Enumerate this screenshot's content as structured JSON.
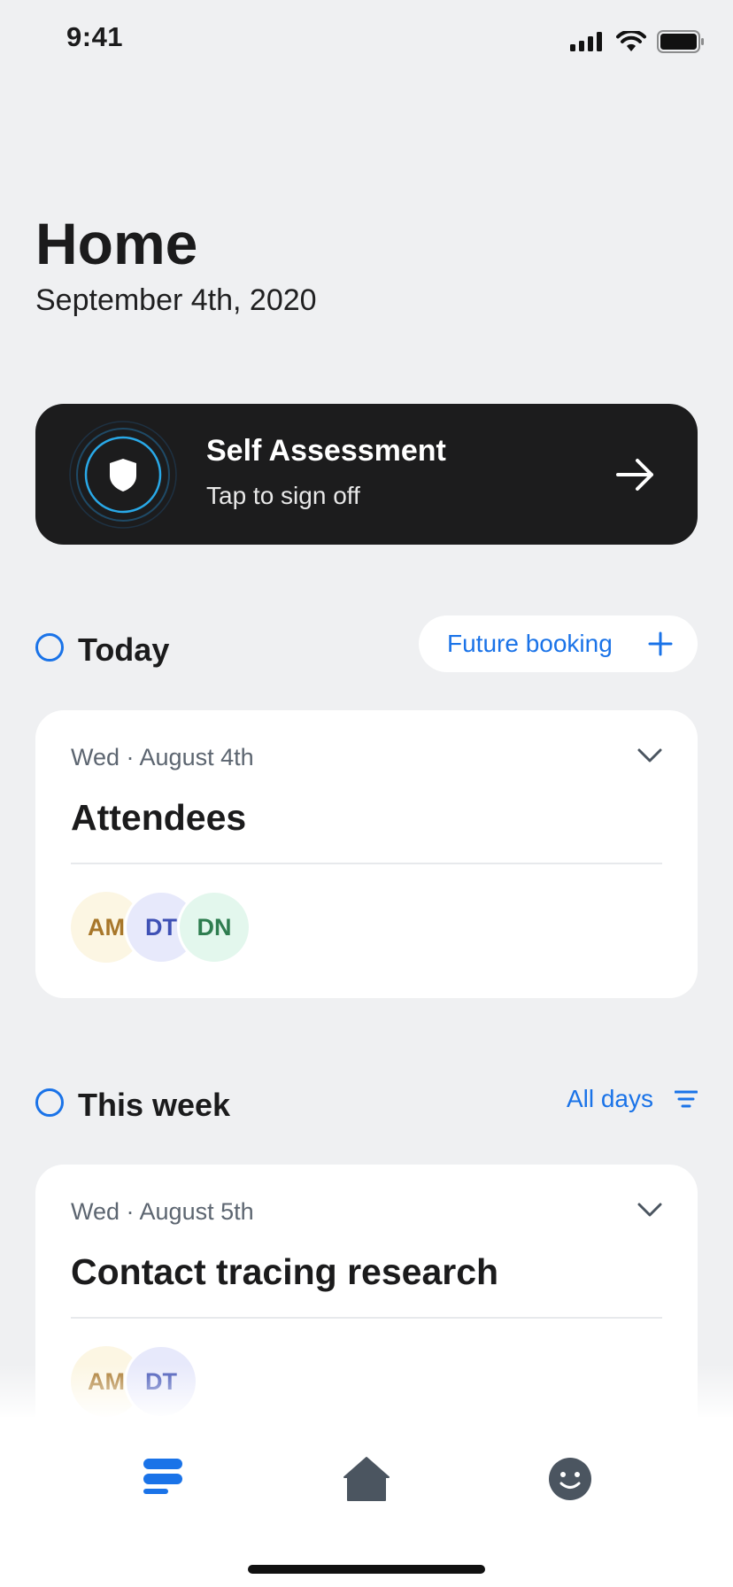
{
  "status": {
    "time": "9:41"
  },
  "header": {
    "title": "Home",
    "date": "September 4th, 2020"
  },
  "self_assessment": {
    "title": "Self Assessment",
    "subtitle": "Tap to sign off"
  },
  "today": {
    "label": "Today",
    "future_booking_label": "Future booking",
    "card": {
      "date": "Wed · August 4th",
      "title": "Attendees",
      "attendees": [
        "AM",
        "DT",
        "DN"
      ]
    }
  },
  "this_week": {
    "label": "This week",
    "filter_label": "All days",
    "card": {
      "date": "Wed · August 5th",
      "title": "Contact tracing research",
      "attendees": [
        "AM",
        "DT"
      ]
    }
  },
  "tabs": [
    "bookings-icon",
    "home-icon",
    "profile-smiley-icon"
  ],
  "colors": {
    "accent": "#1a73e8",
    "card_dark": "#1c1c1d",
    "background": "#eff0f2",
    "tab_inactive": "#4b5560"
  }
}
